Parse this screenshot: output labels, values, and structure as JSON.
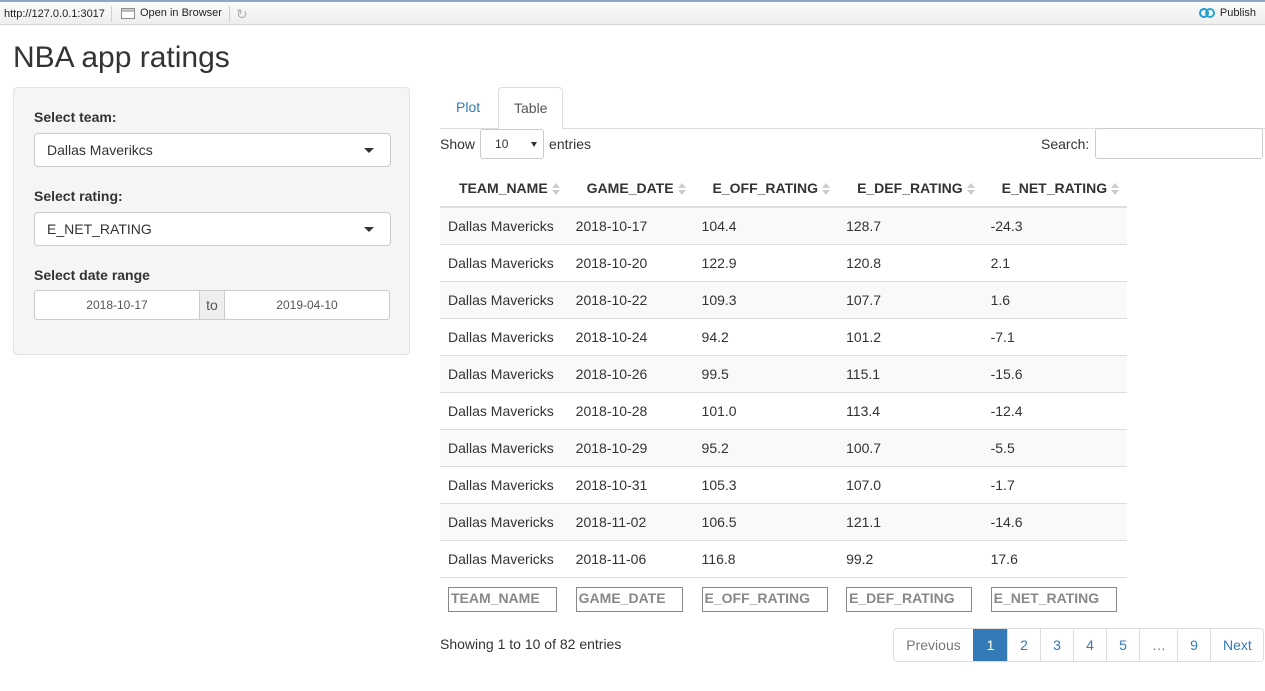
{
  "toolbar": {
    "url": "http://127.0.0.1:3017",
    "open_in_browser": "Open in Browser",
    "publish": "Publish"
  },
  "title": "NBA app ratings",
  "sidebar": {
    "team_label": "Select team:",
    "team_value": "Dallas Maverikcs",
    "rating_label": "Select rating:",
    "rating_value": "E_NET_RATING",
    "date_label": "Select date range",
    "date_start": "2018-10-17",
    "date_to": "to",
    "date_end": "2019-04-10"
  },
  "tabs": [
    {
      "label": "Plot",
      "active": false
    },
    {
      "label": "Table",
      "active": true
    }
  ],
  "table_controls": {
    "show_label": "Show",
    "entries_value": "10",
    "entries_label": "entries",
    "search_label": "Search:",
    "search_value": ""
  },
  "table": {
    "columns": [
      "TEAM_NAME",
      "GAME_DATE",
      "E_OFF_RATING",
      "E_DEF_RATING",
      "E_NET_RATING"
    ],
    "rows": [
      [
        "Dallas Mavericks",
        "2018-10-17",
        "104.4",
        "128.7",
        "-24.3"
      ],
      [
        "Dallas Mavericks",
        "2018-10-20",
        "122.9",
        "120.8",
        "2.1"
      ],
      [
        "Dallas Mavericks",
        "2018-10-22",
        "109.3",
        "107.7",
        "1.6"
      ],
      [
        "Dallas Mavericks",
        "2018-10-24",
        "94.2",
        "101.2",
        "-7.1"
      ],
      [
        "Dallas Mavericks",
        "2018-10-26",
        "99.5",
        "115.1",
        "-15.6"
      ],
      [
        "Dallas Mavericks",
        "2018-10-28",
        "101.0",
        "113.4",
        "-12.4"
      ],
      [
        "Dallas Mavericks",
        "2018-10-29",
        "95.2",
        "100.7",
        "-5.5"
      ],
      [
        "Dallas Mavericks",
        "2018-10-31",
        "105.3",
        "107.0",
        "-1.7"
      ],
      [
        "Dallas Mavericks",
        "2018-11-02",
        "106.5",
        "121.1",
        "-14.6"
      ],
      [
        "Dallas Mavericks",
        "2018-11-06",
        "116.8",
        "99.2",
        "17.6"
      ]
    ],
    "filters": [
      "TEAM_NAME",
      "GAME_DATE",
      "E_OFF_RATING",
      "E_DEF_RATING",
      "E_NET_RATING"
    ]
  },
  "info": "Showing 1 to 10 of 82 entries",
  "pagination": {
    "previous": "Previous",
    "pages": [
      "1",
      "2",
      "3",
      "4",
      "5",
      "…",
      "9"
    ],
    "active_page": "1",
    "next": "Next"
  },
  "colors": {
    "link": "#337ab7",
    "active_page_bg": "#337ab7",
    "sidebar_bg": "#f5f5f5",
    "stripe": "#f9f9f9"
  }
}
